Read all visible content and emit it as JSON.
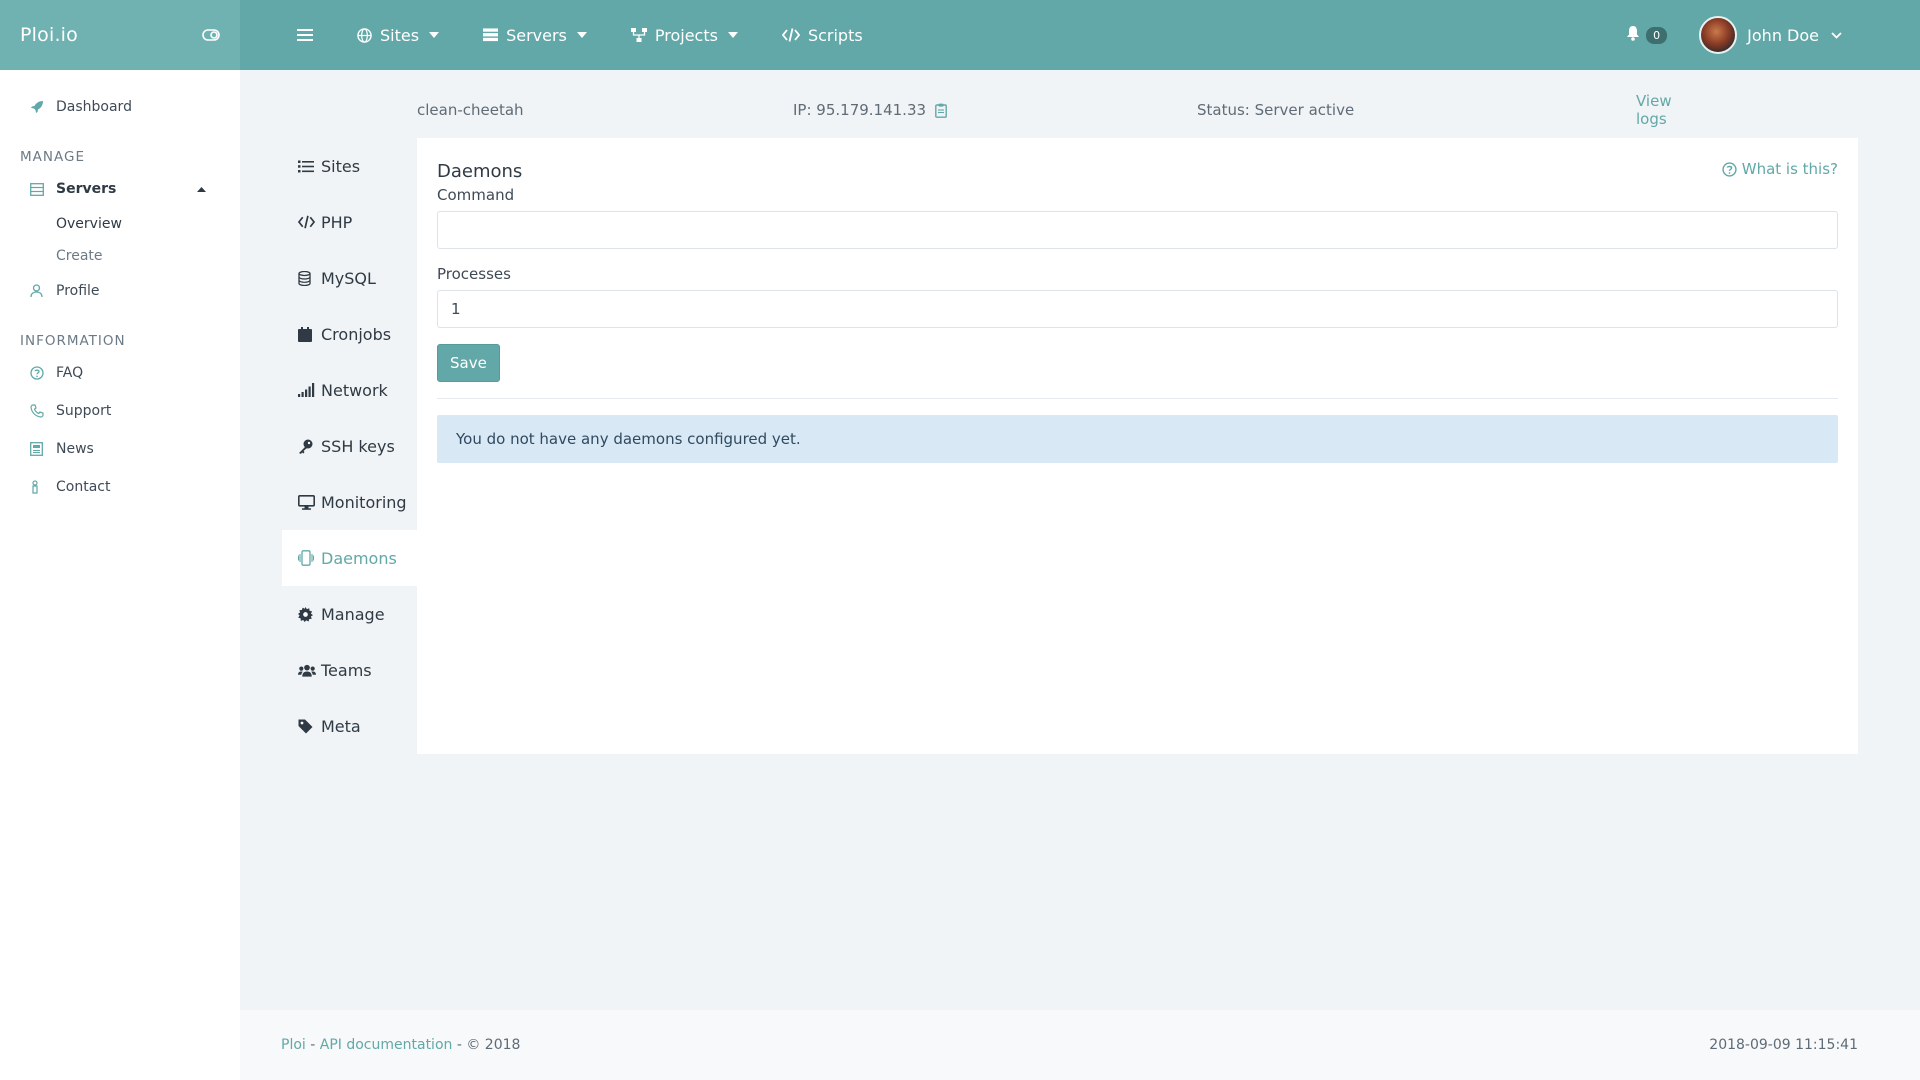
{
  "brand": {
    "name": "Ploi.io"
  },
  "topnav": {
    "items": [
      {
        "label": "Sites",
        "icon": "globe-icon"
      },
      {
        "label": "Servers",
        "icon": "server-icon"
      },
      {
        "label": "Projects",
        "icon": "sitemap-icon"
      },
      {
        "label": "Scripts",
        "icon": "code-icon"
      }
    ],
    "notifications_count": "0",
    "user_name": "John Doe"
  },
  "sidebar": {
    "dashboard": "Dashboard",
    "manage_heading": "MANAGE",
    "servers": "Servers",
    "servers_sub": [
      "Overview",
      "Create"
    ],
    "profile": "Profile",
    "information_heading": "INFORMATION",
    "info_items": [
      "FAQ",
      "Support",
      "News",
      "Contact"
    ]
  },
  "server": {
    "name": "clean-cheetah",
    "ip": "IP: 95.179.141.33",
    "status": "Status: Server active",
    "view_logs": "View logs"
  },
  "subnav": {
    "items": [
      "Sites",
      "PHP",
      "MySQL",
      "Cronjobs",
      "Network",
      "SSH keys",
      "Monitoring",
      "Daemons",
      "Manage",
      "Teams",
      "Meta"
    ],
    "active": "Daemons"
  },
  "panel": {
    "title": "Daemons",
    "help_link": "What is this?",
    "command_label": "Command",
    "command_value": "",
    "processes_label": "Processes",
    "processes_value": "1",
    "save_label": "Save",
    "empty_message": "You do not have any daemons configured yet."
  },
  "footer": {
    "brand_link": "Ploi",
    "separator1": " - ",
    "api_link": "API documentation",
    "copyright": " - © 2018",
    "timestamp": "2018-09-09 11:15:41"
  },
  "colors": {
    "accent": "#62a8a8",
    "brand_bg": "#70b2b1",
    "alert_bg": "#d9e8f5"
  }
}
